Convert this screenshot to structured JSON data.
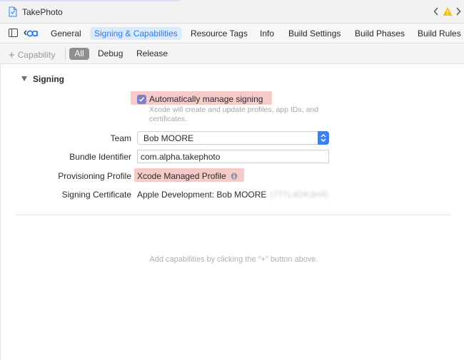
{
  "window": {
    "title": "TakePhoto"
  },
  "tabs": [
    {
      "label": "General",
      "active": false
    },
    {
      "label": "Signing & Capabilities",
      "active": true
    },
    {
      "label": "Resource Tags",
      "active": false
    },
    {
      "label": "Info",
      "active": false
    },
    {
      "label": "Build Settings",
      "active": false
    },
    {
      "label": "Build Phases",
      "active": false
    },
    {
      "label": "Build Rules",
      "active": false
    }
  ],
  "filter": {
    "add_capability": "Capability",
    "segments": [
      "All",
      "Debug",
      "Release"
    ],
    "selected": "All"
  },
  "signing": {
    "section_title": "Signing",
    "auto_manage_label": "Automatically manage signing",
    "auto_manage_checked": true,
    "auto_manage_hint": "Xcode will create and update profiles, app IDs, and certificates.",
    "team_label": "Team",
    "team_value": "Bob MOORE",
    "bundle_label": "Bundle Identifier",
    "bundle_value": "com.alpha.takephoto",
    "profile_label": "Provisioning Profile",
    "profile_value": "Xcode Managed Profile",
    "cert_label": "Signing Certificate",
    "cert_value": "Apple Development: Bob MOORE",
    "cert_id_redacted": "(77TL4GK3H4)"
  },
  "empty_message": "Add capabilities by clicking the \"+\" button above.",
  "colors": {
    "accent": "#2d7bea",
    "highlight": "#f7caca",
    "checkbox": "#7f7fc2",
    "warning": "#f5c000"
  }
}
